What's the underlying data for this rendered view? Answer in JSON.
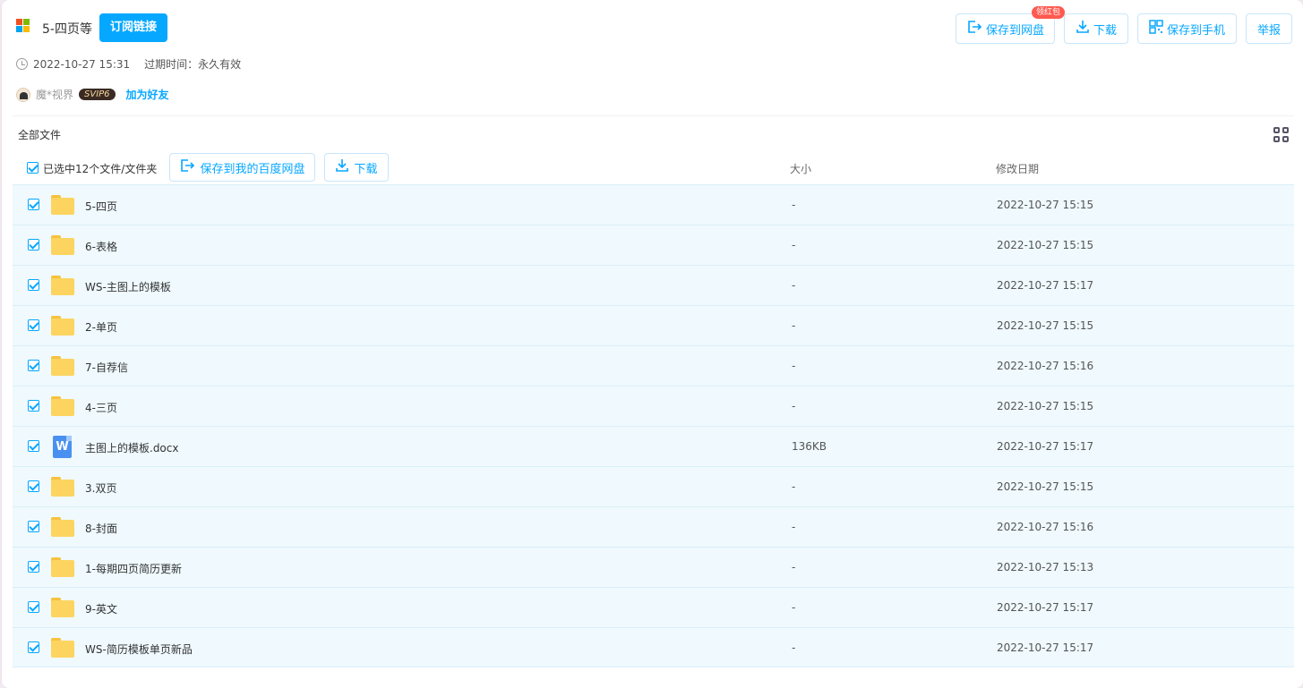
{
  "header": {
    "title": "5-四页等",
    "subscribe_label": "订阅链接",
    "badge": "领红包",
    "actions": {
      "save_to_disk": "保存到网盘",
      "download": "下载",
      "save_to_phone": "保存到手机",
      "report": "举报"
    },
    "timestamp": "2022-10-27 15:31",
    "expire_text": "过期时间：永久有效",
    "user": {
      "name": "魔*视界",
      "vip": "SVIP6",
      "add_friend": "加为好友"
    }
  },
  "list": {
    "breadcrumb": "全部文件",
    "selected_text": "已选中12个文件/文件夹",
    "save_btn": "保存到我的百度网盘",
    "download_btn": "下载",
    "col_size": "大小",
    "col_date": "修改日期",
    "items": [
      {
        "name": "5-四页",
        "size": "-",
        "date": "2022-10-27 15:15",
        "type": "folder"
      },
      {
        "name": "6-表格",
        "size": "-",
        "date": "2022-10-27 15:15",
        "type": "folder"
      },
      {
        "name": "WS-主图上的模板",
        "size": "-",
        "date": "2022-10-27 15:17",
        "type": "folder"
      },
      {
        "name": "2-单页",
        "size": "-",
        "date": "2022-10-27 15:15",
        "type": "folder"
      },
      {
        "name": "7-自荐信",
        "size": "-",
        "date": "2022-10-27 15:16",
        "type": "folder"
      },
      {
        "name": "4-三页",
        "size": "-",
        "date": "2022-10-27 15:15",
        "type": "folder"
      },
      {
        "name": "主图上的模板.docx",
        "size": "136KB",
        "date": "2022-10-27 15:17",
        "type": "doc"
      },
      {
        "name": "3.双页",
        "size": "-",
        "date": "2022-10-27 15:15",
        "type": "folder"
      },
      {
        "name": "8-封面",
        "size": "-",
        "date": "2022-10-27 15:16",
        "type": "folder"
      },
      {
        "name": "1-每期四页简历更新",
        "size": "-",
        "date": "2022-10-27 15:13",
        "type": "folder"
      },
      {
        "name": "9-英文",
        "size": "-",
        "date": "2022-10-27 15:17",
        "type": "folder"
      },
      {
        "name": "WS-简历模板单页新品",
        "size": "-",
        "date": "2022-10-27 15:17",
        "type": "folder"
      }
    ]
  },
  "doc_icon_letter": "W",
  "colors": {
    "accent": "#06a7ff",
    "row_bg": "#eff9fe",
    "folder": "#fcd45f",
    "doc": "#4a90f0",
    "badge": "#ff5a4f"
  }
}
